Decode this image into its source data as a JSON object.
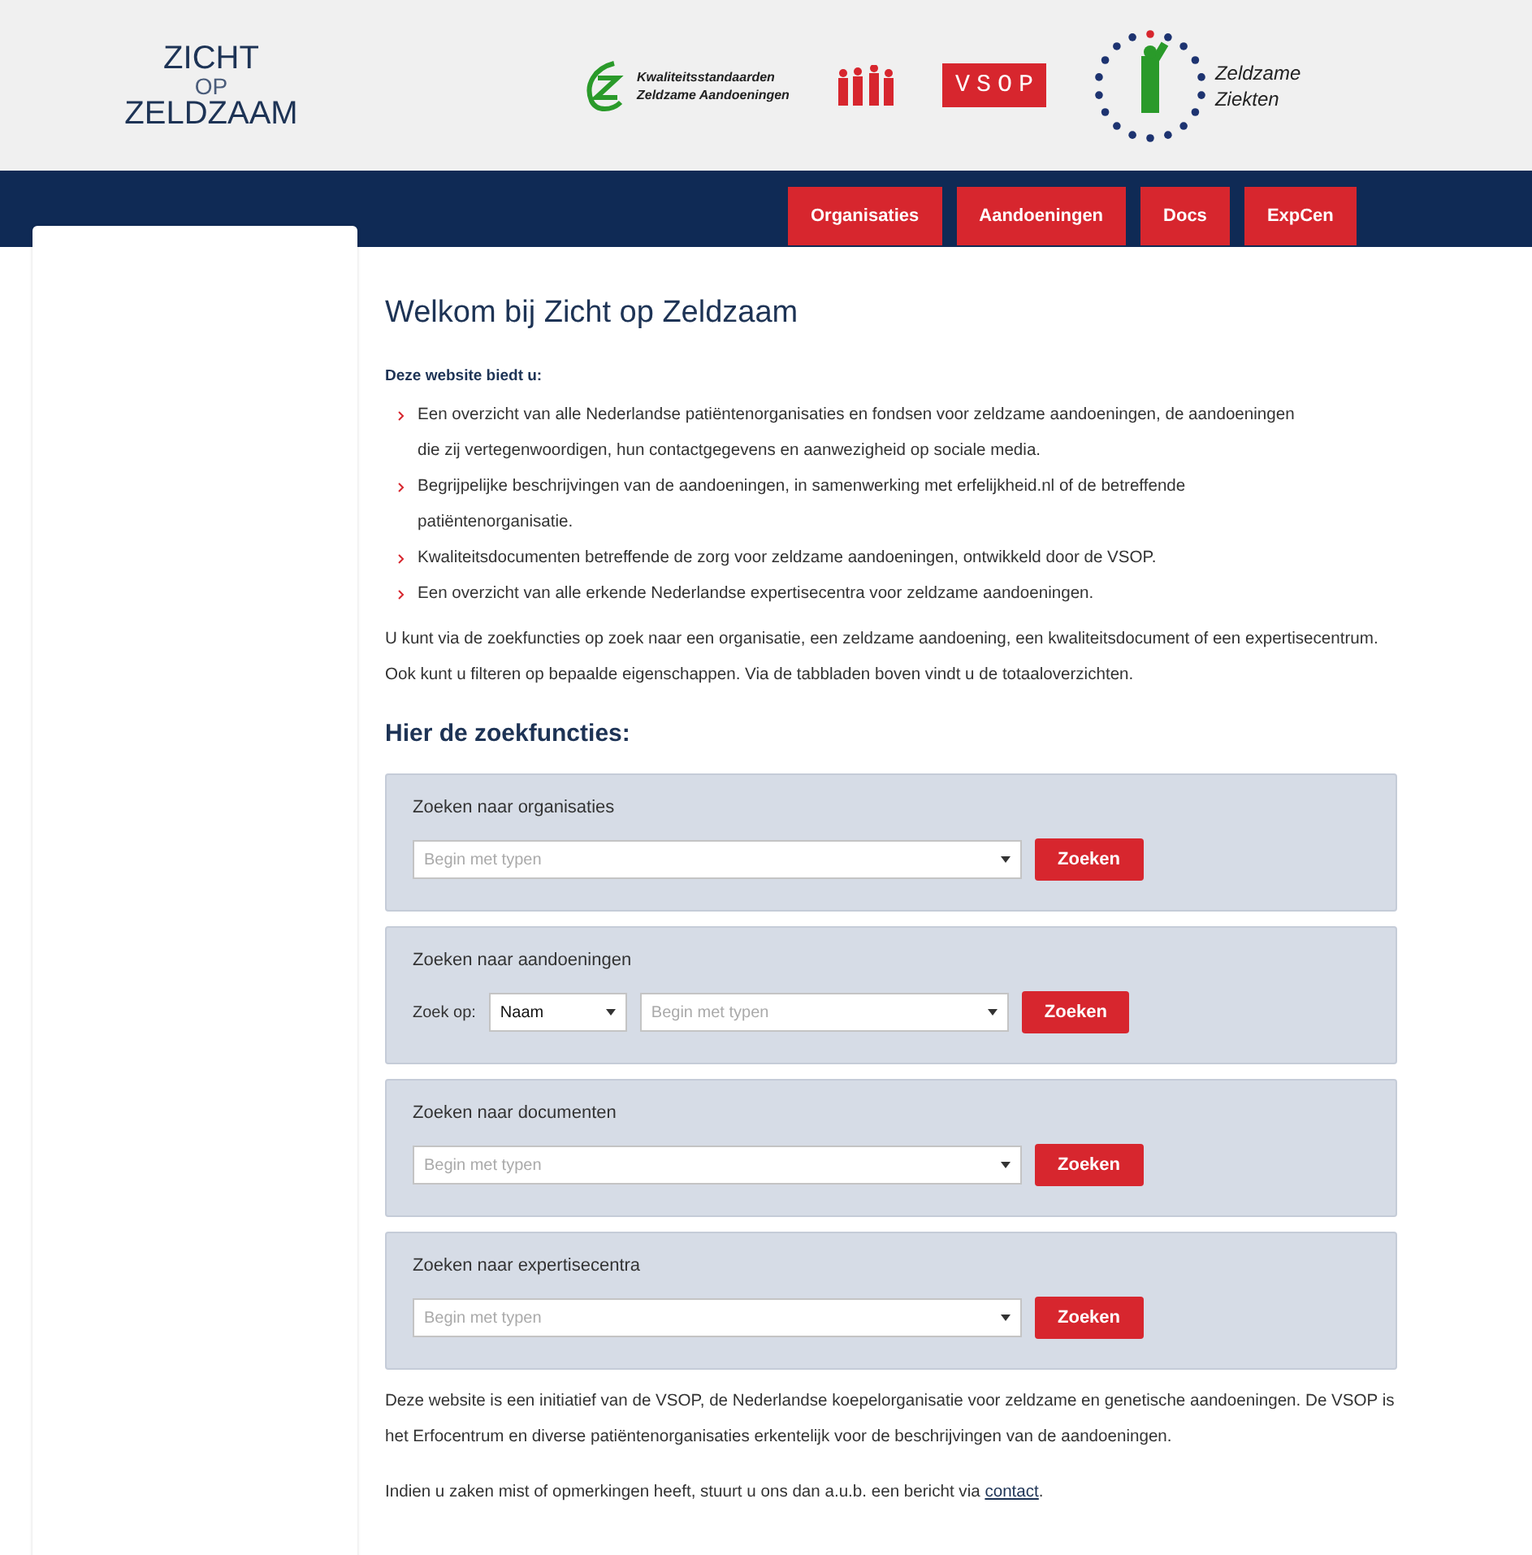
{
  "header": {
    "site_logo": [
      "ZICHT",
      "OP",
      "ZELDZAAM"
    ],
    "partner_logos": [
      {
        "kind": "kwaliteit",
        "lines": [
          "Kwaliteitsstandaarden",
          "Zeldzame Aandoeningen"
        ]
      },
      {
        "kind": "family"
      },
      {
        "kind": "vsop",
        "lines": [
          "VSOP"
        ]
      },
      {
        "kind": "ziekten",
        "lines": [
          "Zeldzame",
          "Ziekten"
        ]
      }
    ]
  },
  "nav": {
    "tabs": [
      {
        "label": "Organisaties"
      },
      {
        "label": "Aandoeningen"
      },
      {
        "label": "Docs"
      },
      {
        "label": "ExpCen"
      }
    ]
  },
  "main": {
    "title": "Welkom bij Zicht op Zeldzaam",
    "intro_heading": "Deze website biedt u:",
    "bullets": [
      "Een overzicht van alle Nederlandse patiëntenorganisaties en fondsen voor zeldzame aandoeningen, de aandoeningen die zij vertegenwoordigen, hun contactgegevens en aanwezigheid op sociale media.",
      "Begrijpelijke beschrijvingen van de aandoeningen, in samenwerking met erfelijkheid.nl of de betreffende patiëntenorganisatie.",
      "Kwaliteitsdocumenten betreffende de zorg voor zeldzame aandoeningen, ontwikkeld door de VSOP.",
      "Een overzicht van alle erkende Nederlandse expertisecentra voor zeldzame aandoeningen."
    ],
    "paragraph": "U kunt via de zoekfuncties op zoek naar een organisatie, een zeldzame aandoening, een kwaliteitsdocument of een expertisecentrum. Ook kunt u filteren op bepaalde eigenschappen. Via de tabbladen boven vindt u de totaaloverzichten.",
    "search_heading": "Hier de zoekfuncties:",
    "search_panels": [
      {
        "kind": "simple",
        "title": "Zoeken naar organisaties",
        "placeholder": "Begin met typen",
        "button": "Zoeken"
      },
      {
        "kind": "filtered",
        "title": "Zoeken naar aandoeningen",
        "filter_label": "Zoek op:",
        "filter_value": "Naam",
        "placeholder": "Begin met typen",
        "button": "Zoeken"
      },
      {
        "kind": "simple",
        "title": "Zoeken naar documenten",
        "placeholder": "Begin met typen",
        "button": "Zoeken"
      },
      {
        "kind": "simple",
        "title": "Zoeken naar expertisecentra",
        "placeholder": "Begin met typen",
        "button": "Zoeken"
      }
    ],
    "footer_paragraph": "Deze website is een initiatief van de VSOP, de Nederlandse koepelorganisatie voor zeldzame en genetische aandoeningen. De VSOP is het Erfocentrum en diverse patiëntenorganisaties erkentelijk voor de beschrijvingen van de aandoeningen.",
    "contact_sentence": {
      "before": "Indien u zaken mist of opmerkingen heeft, stuurt u ons dan a.u.b. een bericht via ",
      "link": "contact",
      "after": "."
    }
  }
}
